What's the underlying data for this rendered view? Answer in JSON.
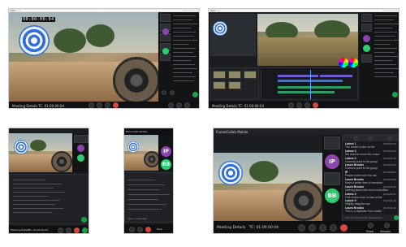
{
  "colors": {
    "accent_green": "#16a34a",
    "accent_blue": "#2f6fd8",
    "dark_bg": "#1a1c1f",
    "tile_purple": "#8e44ad",
    "tile_green": "#2ecc71"
  },
  "screen1": {
    "timecode": "00:00:00:04",
    "footer_label": "Meeting Details",
    "footer_tc": "TC: 01:00:00:04"
  },
  "screen2": {
    "footer_label": "Meeting Details",
    "footer_tc": "TC: 01:00:00:04"
  },
  "screen3": {
    "footer_label": "Meeting Details",
    "footer_tc": "TC: 01:00:00:04"
  },
  "screen4": {
    "title": "FilmCollab Mobile",
    "avatars": [
      "IP",
      "BB"
    ],
    "chat_placeholder": "Type a message",
    "stop_label": "Stop"
  },
  "screen5": {
    "title": "FrameCollab Mobile",
    "avatars": [
      "IP",
      "BB"
    ],
    "chat": [
      {
        "name": "Latest 1",
        "time": "00:00:00:14",
        "text": "The render is live on the"
      },
      {
        "name": "Latest 2",
        "time": "00:00:00:22",
        "text": "We need to move the cursor"
      },
      {
        "name": "Latest 3",
        "time": "00:00:01:15",
        "text": "Connect point to the group"
      },
      {
        "name": "Laura Brooks",
        "time": "00:00:00:47",
        "text": "Connect point to the group"
      },
      {
        "name": "IP",
        "time": "00:00:00:51",
        "text": "Please make sure the mix"
      },
      {
        "name": "Laura Brooks",
        "time": "00:00:00:55",
        "text": "Need a better time to transition"
      },
      {
        "name": "Laura Brooks",
        "time": "00:00:01:02",
        "text": "Nothing about this shot to transition"
      },
      {
        "name": "Latest 4",
        "time": "00:00:01:07",
        "text": "Fine works more or less at the"
      },
      {
        "name": "Latest 5",
        "time": "00:00:01:10",
        "text": "Slightly drag the nav"
      },
      {
        "name": "Laura Brooks",
        "time": "00:00:01:15",
        "text": "This is a duplicate from earlier"
      }
    ],
    "chat_placeholder": "Add a comment to the session",
    "footer_label": "Meeting Details",
    "footer_tc": "TC: 01:00:00:04",
    "draw_label": "Draw",
    "session_label": "Session"
  }
}
